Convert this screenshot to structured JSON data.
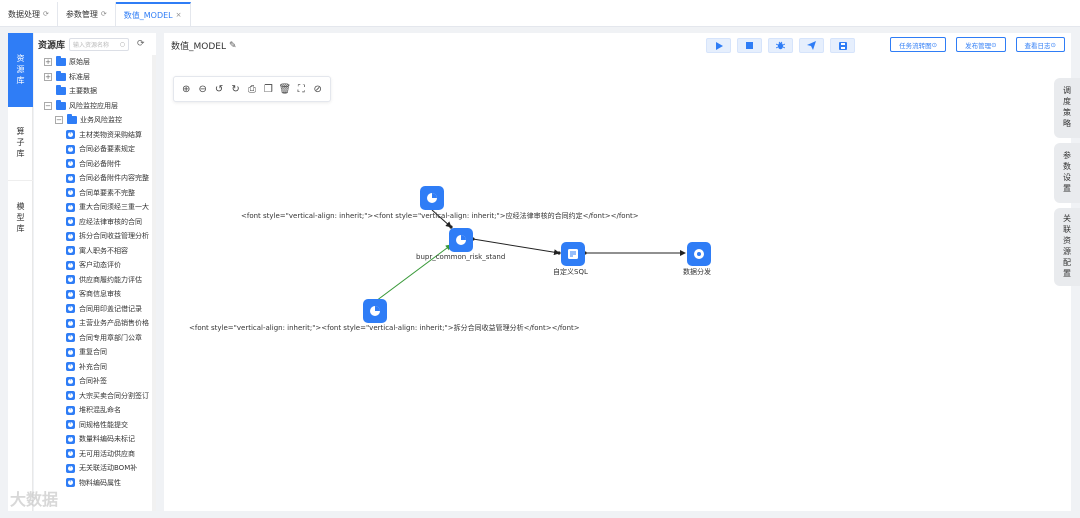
{
  "tabs": [
    {
      "label": "数据处理",
      "icon": "refresh-icon"
    },
    {
      "label": "参数管理",
      "icon": "refresh-icon"
    },
    {
      "label": "数值_MODEL",
      "icon": "close-icon",
      "active": true
    }
  ],
  "tab_icons": {
    "refresh": "⟳",
    "close": "×"
  },
  "vnav": [
    {
      "label": "资源库",
      "active": true
    },
    {
      "label": "算子库"
    },
    {
      "label": "模型库"
    }
  ],
  "resource": {
    "title": "资源库",
    "search_placeholder": "输入资源名称",
    "tree": [
      {
        "label": "原始层",
        "type": "folder",
        "toggle": "+",
        "indent": 0
      },
      {
        "label": "标准层",
        "type": "folder",
        "toggle": "+",
        "indent": 0
      },
      {
        "label": "主要数据",
        "type": "folder",
        "toggle": "",
        "indent": 0
      },
      {
        "label": "风险监控应用层",
        "type": "folder",
        "toggle": "−",
        "indent": 0
      },
      {
        "label": "业务风险监控",
        "type": "folder",
        "toggle": "−",
        "indent": 1
      },
      {
        "label": "主材类物资采购结算",
        "type": "leaf",
        "indent": 2
      },
      {
        "label": "合同必备要素规定",
        "type": "leaf",
        "indent": 2
      },
      {
        "label": "合同必备附件",
        "type": "leaf",
        "indent": 2
      },
      {
        "label": "合同必备附件内容完整",
        "type": "leaf",
        "indent": 2
      },
      {
        "label": "合同单要素不完整",
        "type": "leaf",
        "indent": 2
      },
      {
        "label": "重大合同须经三重一大",
        "type": "leaf",
        "indent": 2
      },
      {
        "label": "应经法律审核的合同",
        "type": "leaf",
        "indent": 2
      },
      {
        "label": "拆分合同收益管理分析",
        "type": "leaf",
        "indent": 2
      },
      {
        "label": "寓人职务不相容",
        "type": "leaf",
        "indent": 2
      },
      {
        "label": "客户动态评价",
        "type": "leaf",
        "indent": 2
      },
      {
        "label": "供应商履约能力评估",
        "type": "leaf",
        "indent": 2
      },
      {
        "label": "客商信息审核",
        "type": "leaf",
        "indent": 2
      },
      {
        "label": "合同用印盖记借记录",
        "type": "leaf",
        "indent": 2
      },
      {
        "label": "主营业务产品销售价格",
        "type": "leaf",
        "indent": 2
      },
      {
        "label": "合同专用章部门公章",
        "type": "leaf",
        "indent": 2
      },
      {
        "label": "重复合同",
        "type": "leaf",
        "indent": 2
      },
      {
        "label": "补充合同",
        "type": "leaf",
        "indent": 2
      },
      {
        "label": "合同补签",
        "type": "leaf",
        "indent": 2
      },
      {
        "label": "大宗买卖合同分割签订",
        "type": "leaf",
        "indent": 2
      },
      {
        "label": "堆积混乱命名",
        "type": "leaf",
        "indent": 2
      },
      {
        "label": "同规格性能提交",
        "type": "leaf",
        "indent": 2
      },
      {
        "label": "数量料编码未标记",
        "type": "leaf",
        "indent": 2
      },
      {
        "label": "无可用活动供应商",
        "type": "leaf",
        "indent": 2
      },
      {
        "label": "无关联活动BOM补",
        "type": "leaf",
        "indent": 2
      },
      {
        "label": "物料编码属性",
        "type": "leaf",
        "indent": 2
      }
    ]
  },
  "main": {
    "title": "数值_MODEL",
    "tool_buttons": [
      {
        "name": "run-icon"
      },
      {
        "name": "stop-icon"
      },
      {
        "name": "debug-icon"
      },
      {
        "name": "send-icon"
      },
      {
        "name": "save-icon"
      }
    ],
    "links": [
      {
        "label": "任务流转图",
        "name": "task-flow-button"
      },
      {
        "label": "发布管理",
        "name": "publish-manage-button"
      },
      {
        "label": "查看日志",
        "name": "view-log-button"
      }
    ],
    "link_suffix": "⊙",
    "zoom_tools": [
      {
        "glyph": "⊕",
        "name": "zoom-in-icon"
      },
      {
        "glyph": "⊖",
        "name": "zoom-out-icon"
      },
      {
        "glyph": "↺",
        "name": "undo-icon"
      },
      {
        "glyph": "↻",
        "name": "redo-icon"
      },
      {
        "glyph": "⎙",
        "name": "export-icon"
      },
      {
        "glyph": "❐",
        "name": "copy-icon"
      },
      {
        "glyph": "🗑",
        "name": "delete-icon"
      },
      {
        "glyph": "⛶",
        "name": "fullscreen-icon"
      },
      {
        "glyph": "⊘",
        "name": "reset-icon"
      }
    ],
    "nodes": [
      {
        "id": "n1",
        "label": "<font style=\"vertical-align: inherit;\"><font style=\"vertical-align: inherit;\">应经法律审核的合同约定</font></font>"
      },
      {
        "id": "n2",
        "label": "bupr_common_risk_stand"
      },
      {
        "id": "n3",
        "label": "<font style=\"vertical-align: inherit;\"><font style=\"vertical-align: inherit;\">拆分合同收益管理分析</font></font>"
      },
      {
        "id": "n4",
        "label": "自定义SQL"
      },
      {
        "id": "n5",
        "label": "数据分发"
      }
    ]
  },
  "drawers": [
    {
      "label": "调度策略"
    },
    {
      "label": "参数设置"
    },
    {
      "label": "关联资源配置"
    }
  ],
  "colors": {
    "accent": "#2f7df6",
    "edge_green": "#3a9a3a",
    "edge_dark": "#222222"
  },
  "watermark": "大数据"
}
